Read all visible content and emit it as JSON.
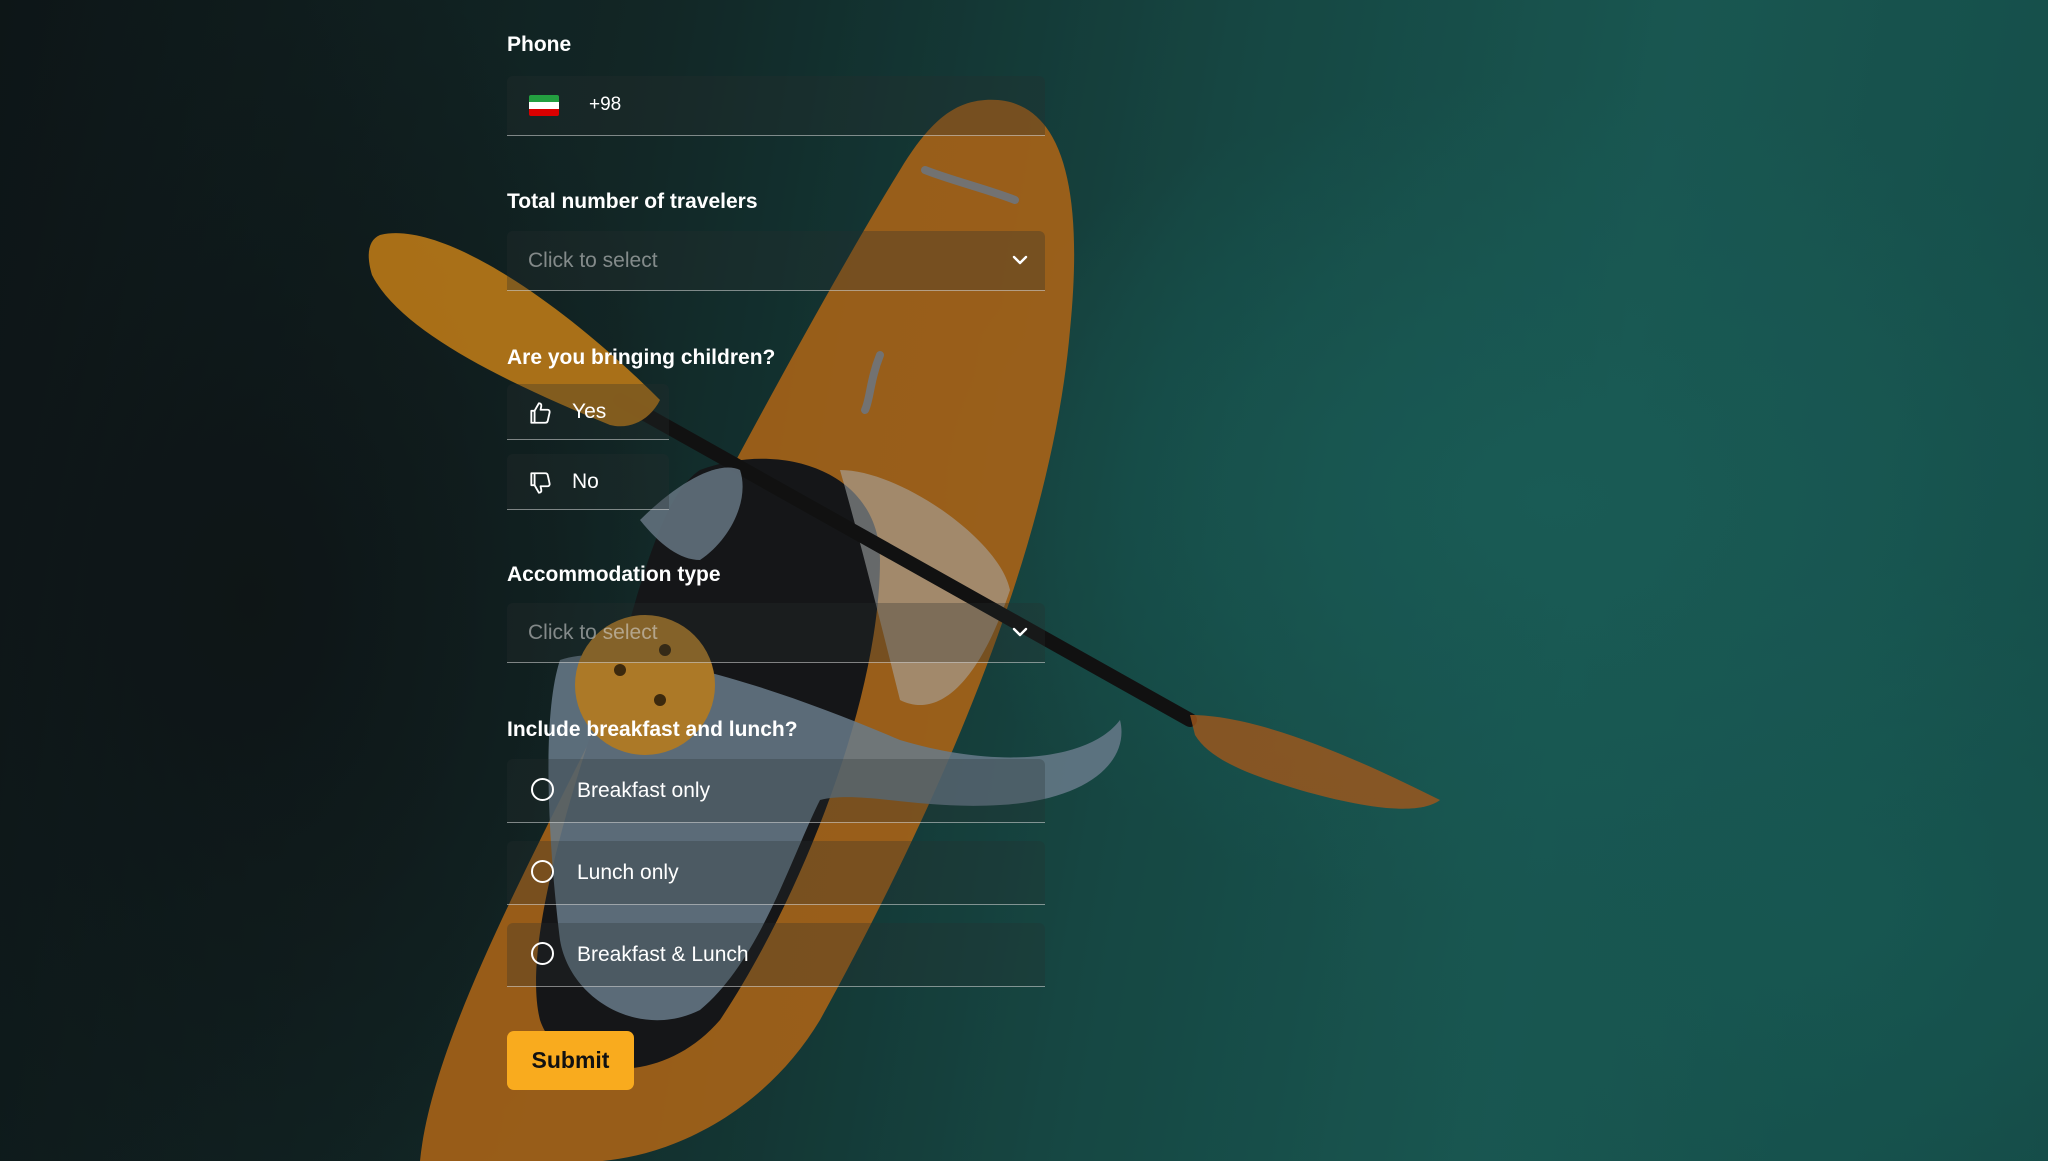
{
  "form": {
    "phone": {
      "label": "Phone",
      "country_code": "+98",
      "flag_icon": "iran-flag-icon",
      "flag_colors": [
        "#239f40",
        "#ffffff",
        "#da0000"
      ]
    },
    "travelers": {
      "label": "Total number of travelers",
      "placeholder": "Click to select",
      "icon": "chevron-down-icon"
    },
    "children": {
      "label": "Are you bringing children?",
      "options": [
        {
          "label": "Yes",
          "icon": "thumbs-up-icon"
        },
        {
          "label": "No",
          "icon": "thumbs-down-icon"
        }
      ]
    },
    "accommodation": {
      "label": "Accommodation type",
      "placeholder": "Click to select",
      "icon": "chevron-down-icon"
    },
    "meals": {
      "label": "Include breakfast and lunch?",
      "options": [
        {
          "label": "Breakfast only",
          "selected": false
        },
        {
          "label": "Lunch only",
          "selected": false
        },
        {
          "label": "Breakfast & Lunch",
          "selected": false
        }
      ]
    },
    "submit_label": "Submit"
  },
  "colors": {
    "accent": "#f9ab1e",
    "background": "#1b5651"
  }
}
